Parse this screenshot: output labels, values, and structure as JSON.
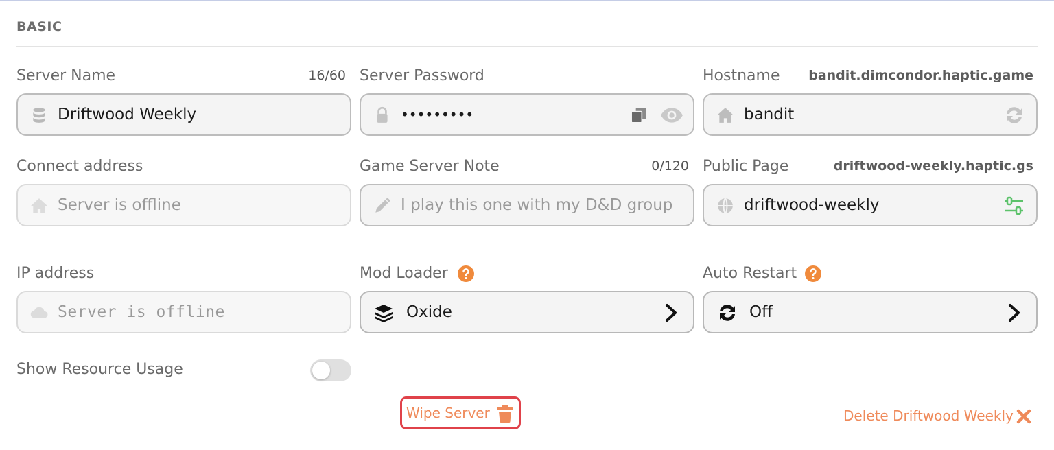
{
  "section": {
    "title": "BASIC"
  },
  "server_name": {
    "label": "Server Name",
    "counter": "16/60",
    "value": "Driftwood Weekly",
    "icon": "database-icon"
  },
  "server_password": {
    "label": "Server Password",
    "value": "•••••••••",
    "icon": "lock-icon",
    "copy_icon": "copy-icon",
    "reveal_icon": "eye-icon"
  },
  "hostname": {
    "label": "Hostname",
    "domain": "bandit.dimcondor.haptic.game",
    "value": "bandit",
    "icon": "home-icon",
    "action_icon": "refresh-icon"
  },
  "connect_address": {
    "label": "Connect address",
    "placeholder": "Server is offline",
    "icon": "home-icon"
  },
  "game_server_note": {
    "label": "Game Server Note",
    "counter": "0/120",
    "placeholder": "I play this one with my D&D group",
    "icon": "pencil-icon"
  },
  "public_page": {
    "label": "Public Page",
    "domain": "driftwood-weekly.haptic.gs",
    "value": "driftwood-weekly",
    "icon": "globe-icon",
    "action_icon": "sliders-icon"
  },
  "ip_address": {
    "label": "IP address",
    "placeholder": "Server is offline",
    "icon": "cloud-icon"
  },
  "mod_loader": {
    "label": "Mod Loader",
    "value": "Oxide",
    "icon": "layers-icon",
    "help_icon": "help-icon"
  },
  "auto_restart": {
    "label": "Auto Restart",
    "value": "Off",
    "icon": "sync-icon",
    "help_icon": "help-icon"
  },
  "resource_usage": {
    "label": "Show Resource Usage",
    "enabled": false
  },
  "actions": {
    "wipe_label": "Wipe Server",
    "delete_label": "Delete Driftwood Weekly"
  },
  "colors": {
    "accent": "#ef8a5a",
    "danger_border": "#e0424a",
    "help": "#f08a3c",
    "success": "#5cc26a"
  }
}
